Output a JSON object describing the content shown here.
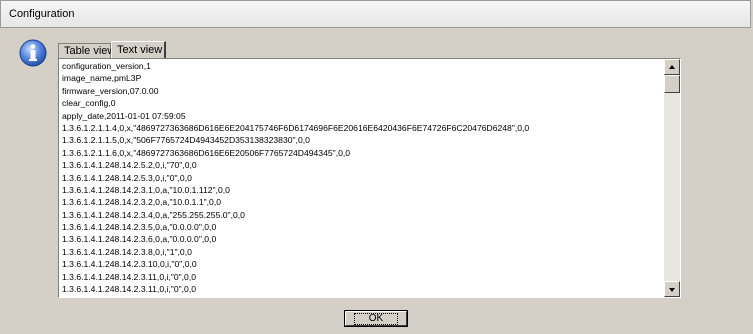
{
  "window": {
    "title": "Configuration"
  },
  "tabs": [
    {
      "label": "Table view",
      "selected": false
    },
    {
      "label": "Text view",
      "selected": true
    }
  ],
  "text_view": {
    "lines": [
      "configuration_version,1",
      "image_name,pmL3P",
      "firmware_version,07.0.00",
      "clear_config,0",
      "apply_date,2011-01-01 07:59:05",
      "1.3.6.1.2.1.1.4,0,x,\"4869727363686D616E6E204175746F6D6174696F6E20616E6420436F6E74726F6C20476D6248\",0,0",
      "1.3.6.1.2.1.1.5,0,x,\"506F7765724D4943452D353138323830\",0,0",
      "1.3.6.1.2.1.1.6,0,x,\"4869727363686D616E6E20506F7765724D494345\",0,0",
      "1.3.6.1.4.1.248.14.2.5.2,0,i,\"70\",0,0",
      "1.3.6.1.4.1.248.14.2.5.3,0,i,\"0\",0,0",
      "1.3.6.1.4.1.248.14.2.3.1,0,a,\"10.0.1.112\",0,0",
      "1.3.6.1.4.1.248.14.2.3.2,0,a,\"10.0.1.1\",0,0",
      "1.3.6.1.4.1.248.14.2.3.4,0,a,\"255.255.255.0\",0,0",
      "1.3.6.1.4.1.248.14.2.3.5,0,a,\"0.0.0.0\",0,0",
      "1.3.6.1.4.1.248.14.2.3.6,0,a,\"0.0.0.0\",0,0",
      "1.3.6.1.4.1.248.14.2.3.8,0,i,\"1\",0,0",
      "1.3.6.1.4.1.248.14.2.3.10,0,i,\"0\",0,0",
      "1.3.6.1.4.1.248.14.2.3.11,0,i,\"0\",0,0",
      "1.3.6.1.4.1.248.14.2.3.11,0,i,\"0\",0,0"
    ]
  },
  "buttons": {
    "ok_label": "OK"
  },
  "icons": {
    "info": "info-icon",
    "scroll_up": "arrow-up-icon",
    "scroll_down": "arrow-down-icon"
  },
  "colors": {
    "window_bg": "#d4d0c8",
    "info_icon_blue": "#2d5fb5"
  }
}
